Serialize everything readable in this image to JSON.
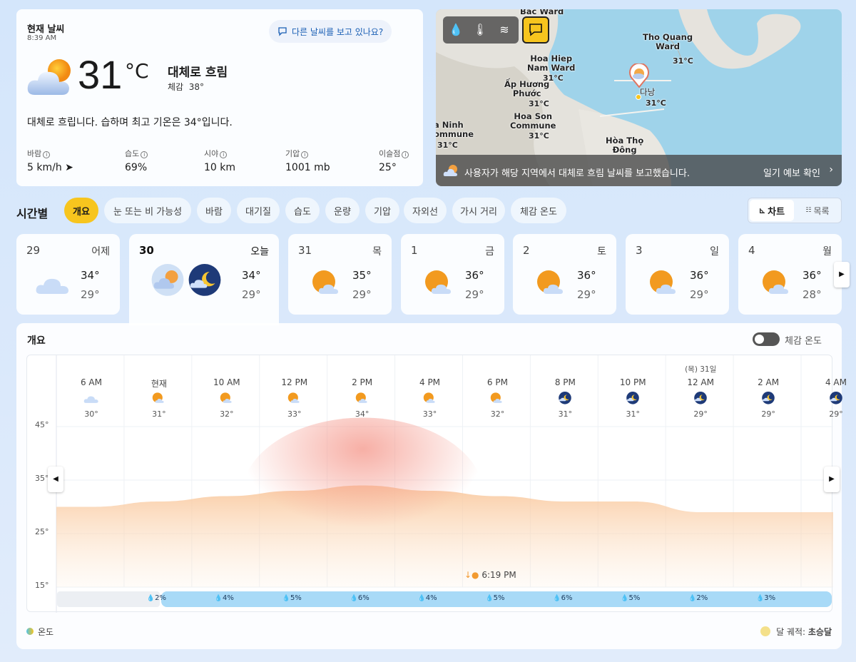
{
  "current": {
    "title": "현재 날씨",
    "time": "8:39 AM",
    "feedback": "다른 날씨를 보고 있나요?",
    "temp": "31",
    "unit": "°C",
    "condition": "대체로 흐림",
    "feels_label": "체감",
    "feels_value": "38°",
    "description": "대체로 흐립니다. 습하며 최고 기온은 34°입니다.",
    "stats": [
      {
        "label": "바람",
        "value": "5 km/h"
      },
      {
        "label": "습도",
        "value": "69%"
      },
      {
        "label": "시야",
        "value": "10 km"
      },
      {
        "label": "기압",
        "value": "1001 mb"
      },
      {
        "label": "이슬점",
        "value": "25°"
      }
    ]
  },
  "map": {
    "labels": [
      {
        "text": "Bac Ward"
      },
      {
        "text": "Tho Quang\nWard"
      },
      {
        "text": "Hoa Hiep\nNam Ward"
      },
      {
        "text": "Ấp Hương\nPhước"
      },
      {
        "text": "Hoa Son\nCommune"
      },
      {
        "text": "a Ninh\nommune"
      },
      {
        "text": "다낭"
      },
      {
        "text": "Hòa Thọ\nĐông"
      }
    ],
    "temps": [
      "31°C",
      "31°C",
      "31°C",
      "31°C",
      "31°C",
      "31°C"
    ],
    "bar_text": "사용자가 해당 지역에서 대체로 흐림 날씨를 보고했습니다.",
    "bar_link": "일기 예보 확인"
  },
  "hourly": {
    "title": "시간별",
    "chips": [
      "개요",
      "눈 또는 비 가능성",
      "바람",
      "대기질",
      "습도",
      "운량",
      "기압",
      "자외선",
      "가시 거리",
      "체감 온도"
    ],
    "view_chart": "차트",
    "view_list": "목록"
  },
  "days": [
    {
      "num": "29",
      "name": "어제",
      "hi": "34°",
      "lo": "29°",
      "icon": "cloudy-icon"
    },
    {
      "num": "30",
      "name": "오늘",
      "hi": "34°",
      "lo": "29°",
      "icon": "partly-cloudy-day-night-icon"
    },
    {
      "num": "31",
      "name": "목",
      "hi": "35°",
      "lo": "29°",
      "icon": "partly-sunny-icon"
    },
    {
      "num": "1",
      "name": "금",
      "hi": "36°",
      "lo": "29°",
      "icon": "partly-sunny-icon"
    },
    {
      "num": "2",
      "name": "토",
      "hi": "36°",
      "lo": "29°",
      "icon": "partly-sunny-icon"
    },
    {
      "num": "3",
      "name": "일",
      "hi": "36°",
      "lo": "29°",
      "icon": "partly-sunny-icon"
    },
    {
      "num": "4",
      "name": "월",
      "hi": "36°",
      "lo": "28°",
      "icon": "partly-sunny-icon"
    }
  ],
  "chart_card": {
    "title": "개요",
    "feels_toggle": "체감 온도",
    "sunset": "6:19 PM",
    "legend_temp": "온도",
    "moon_label": "달 궤적:",
    "moon_value": "초승달"
  },
  "chart_data": {
    "type": "area",
    "hours": [
      "6 AM",
      "현재",
      "10 AM",
      "12 PM",
      "2 PM",
      "4 PM",
      "6 PM",
      "8 PM",
      "10 PM",
      "12 AM",
      "2 AM",
      "4 AM"
    ],
    "hour_sub": [
      "",
      "",
      "",
      "",
      "",
      "",
      "",
      "",
      "",
      "(목) 31일",
      "",
      ""
    ],
    "temps": [
      30,
      31,
      32,
      33,
      34,
      33,
      32,
      31,
      31,
      29,
      29,
      29
    ],
    "precip": [
      "2%",
      "4%",
      "5%",
      "6%",
      "4%",
      "5%",
      "6%",
      "5%",
      "2%",
      "3%"
    ],
    "yticks": [
      "45°",
      "35°",
      "25°",
      "15°"
    ],
    "ylim": [
      15,
      45
    ]
  }
}
